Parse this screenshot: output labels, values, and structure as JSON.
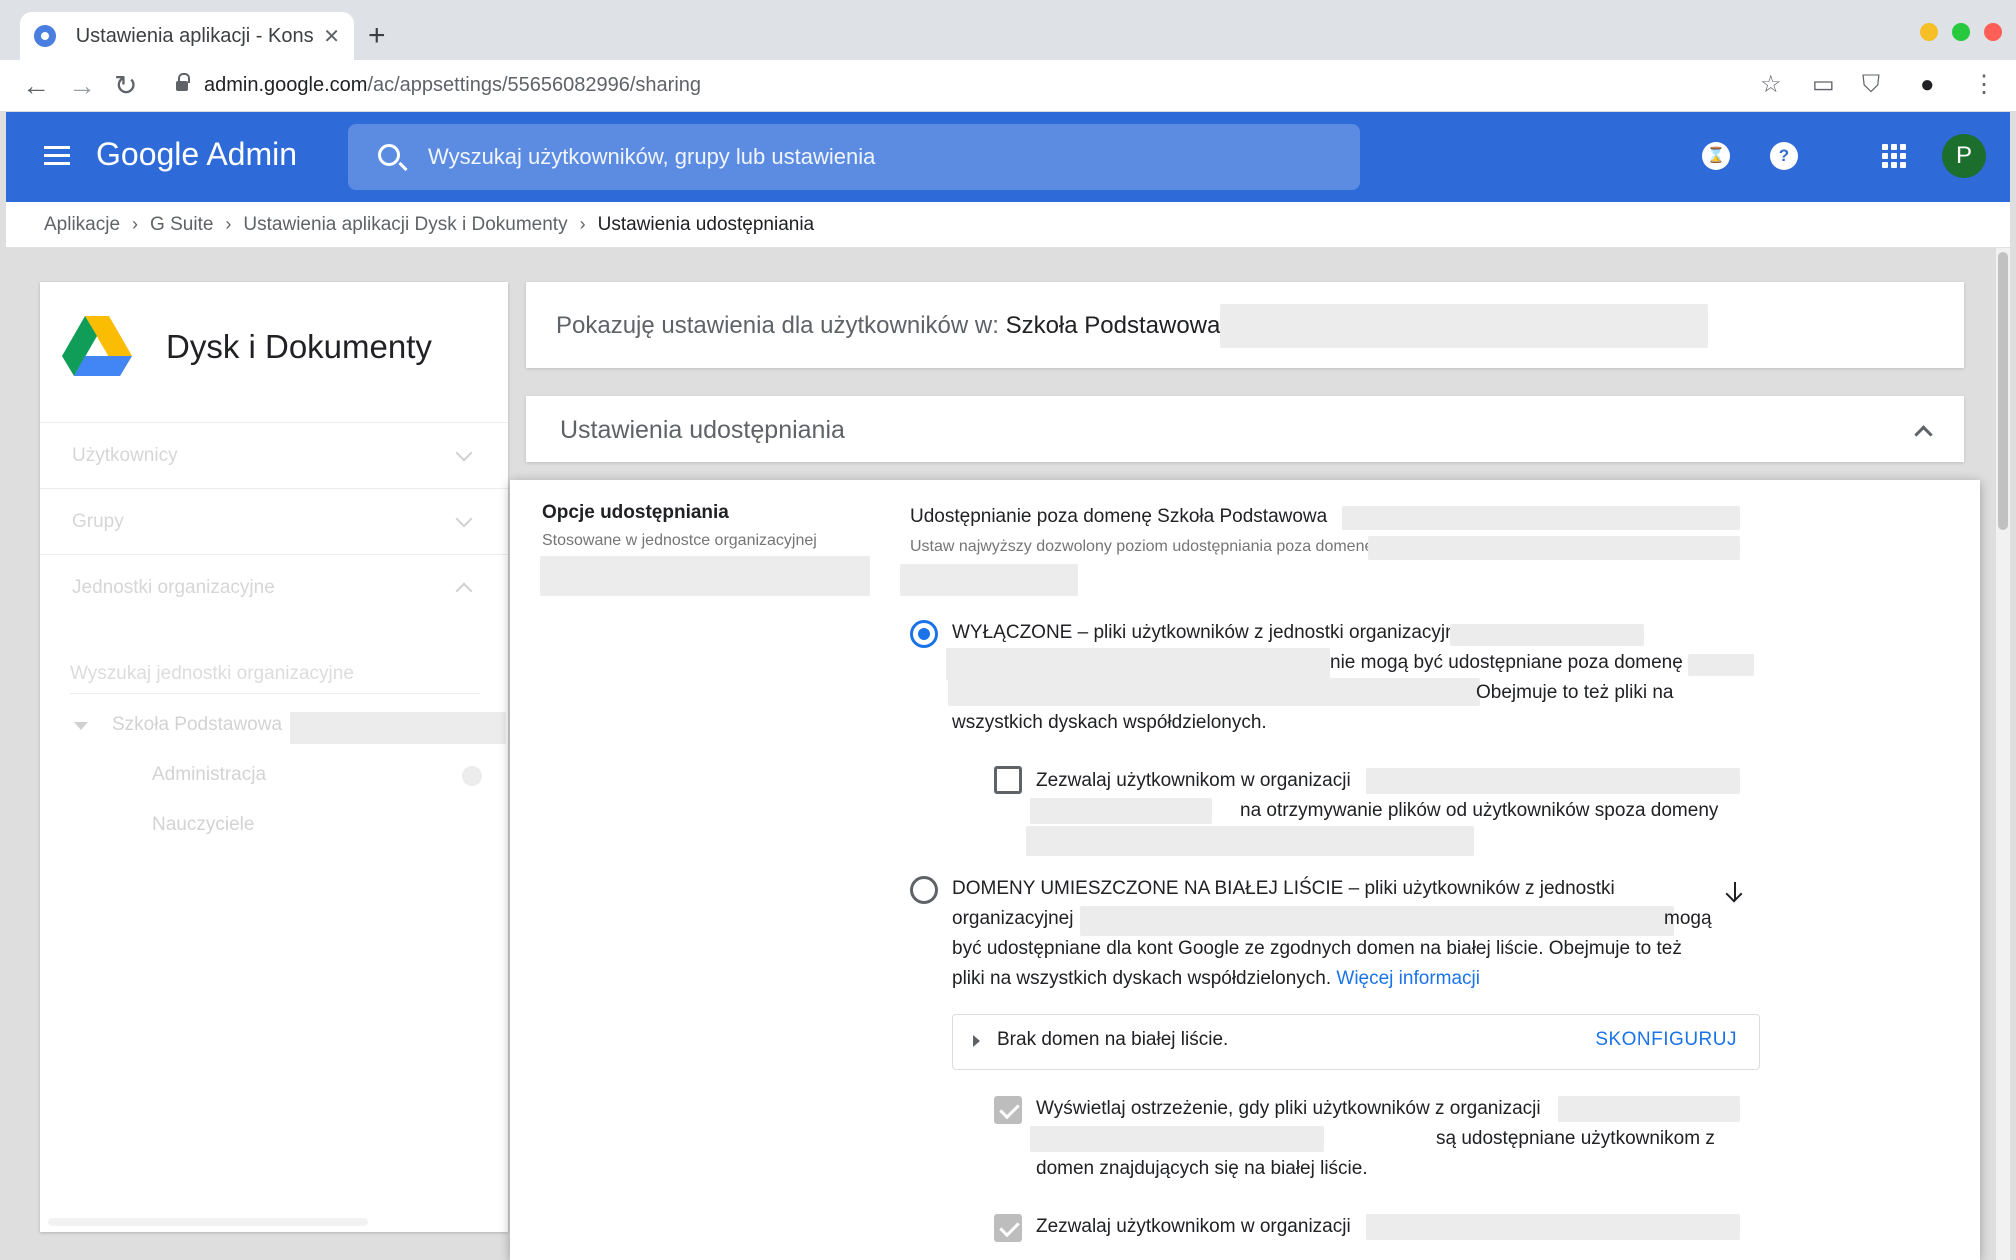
{
  "browser": {
    "tab_title": "Ustawienia aplikacji - Kons",
    "tab_close": "✕",
    "new_tab": "+",
    "url_host": "admin.google.com",
    "url_path": "/ac/appsettings/55656082996/sharing",
    "icons": [
      "back-arrow-icon",
      "forward-arrow-icon",
      "reload-icon",
      "lock-icon",
      "star-icon",
      "cast-icon",
      "shield-extension-icon",
      "account-icon",
      "more-vert-icon"
    ]
  },
  "header": {
    "brand": "Google Admin",
    "search_placeholder": "Wyszukaj użytkowników, grupy lub ustawienia",
    "hourglass_icon": "⌛",
    "help_icon": "?",
    "avatar_letter": "P"
  },
  "breadcrumb": {
    "items": [
      "Aplikacje",
      "G Suite",
      "Ustawienia aplikacji Dysk i Dokumenty"
    ],
    "current": "Ustawienia udostępniania",
    "separator": "›"
  },
  "sidebar": {
    "title": "Dysk i Dokumenty",
    "rows": [
      "Użytkownicy",
      "Grupy",
      "Jednostki organizacyjne"
    ],
    "ou_search_placeholder": "Wyszukaj jednostki organizacyjne",
    "tree": {
      "root": "Szkoła Podstawowa",
      "children": [
        "Administracja",
        "Nauczyciele"
      ]
    }
  },
  "org_bar": {
    "prefix": "Pokazuję ustawienia dla użytkowników w: ",
    "org_name": "Szkoła Podstawowa"
  },
  "section": {
    "title": "Ustawienia udostępniania"
  },
  "options": {
    "title": "Opcje udostępniania",
    "subtitle": "Stosowane w jednostce organizacyjnej",
    "outside_title": "Udostępnianie poza domenę Szkoła Podstawowa",
    "outside_sub": "Ustaw najwyższy dozwolony poziom udostępniania poza domenę S",
    "off_line1": "WYŁĄCZONE – pliki użytkowników z jednostki organizacyjnej",
    "off_line2": "nie mogą być udostępniane poza domenę",
    "off_line3": "Obejmuje to też pliki na",
    "off_line4": "wszystkich dyskach współdzielonych.",
    "off_cb_line1": "Zezwalaj użytkownikom w organizacji",
    "off_cb_line2": "na otrzymywanie plików od użytkowników spoza domeny",
    "wl_line1": "DOMENY UMIESZCZONE NA BIAŁEJ LIŚCIE – pliki użytkowników z jednostki",
    "wl_line2a": "organizacyjnej",
    "wl_line2b": "mogą",
    "wl_line3": "być udostępniane dla kont Google ze zgodnych domen na białej liście. Obejmuje to też",
    "wl_line4": "pliki na wszystkich dyskach współdzielonych. ",
    "wl_more": "Więcej informacji",
    "wl_box_text": "Brak domen na białej liście.",
    "wl_configure": "SKONFIGURUJ",
    "warn_line1": "Wyświetlaj ostrzeżenie, gdy pliki użytkowników z organizacji",
    "warn_line2": "są udostępniane użytkownikom z",
    "warn_line3": "domen znajdujących się na białej liście.",
    "allow_line1": "Zezwalaj użytkownikom w organizacji"
  },
  "colors": {
    "header_blue": "#2f6bd8",
    "accent": "#1a73e8",
    "avatar_green": "#1c6e2d"
  }
}
